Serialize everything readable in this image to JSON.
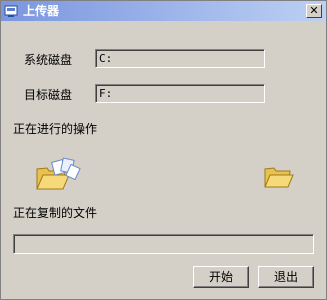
{
  "window": {
    "title": "上传器",
    "close_glyph": "✕"
  },
  "form": {
    "source_disk_label": "系统磁盘",
    "source_disk_value": "C:",
    "target_disk_label": "目标磁盘",
    "target_disk_value": "F:"
  },
  "status": {
    "operation_label": "正在进行的操作",
    "copying_label": "正在复制的文件",
    "progress": 0
  },
  "buttons": {
    "start": "开始",
    "exit": "退出"
  },
  "icons": {
    "app": "uploader-app-icon",
    "source": "open-folder-with-flying-documents",
    "target": "open-folder"
  }
}
